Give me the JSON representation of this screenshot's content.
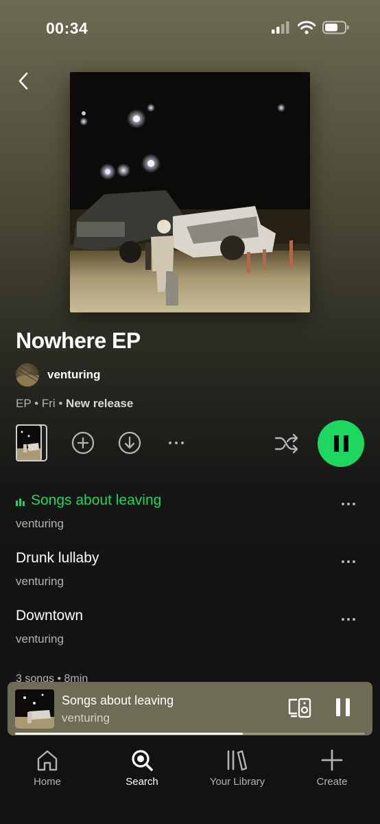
{
  "status_bar": {
    "time": "00:34"
  },
  "album": {
    "title": "Nowhere EP",
    "artist": "venturing",
    "meta": {
      "type": "EP",
      "date": "Fri",
      "tag": "New release"
    }
  },
  "tracks": [
    {
      "title": "Songs about leaving",
      "artist": "venturing",
      "playing": true
    },
    {
      "title": "Drunk lullaby",
      "artist": "venturing",
      "playing": false
    },
    {
      "title": "Downtown",
      "artist": "venturing",
      "playing": false
    }
  ],
  "summary": "3 songs • 8min",
  "mini_player": {
    "title": "Songs about leaving",
    "artist": "venturing",
    "progress": 0.65
  },
  "nav": [
    {
      "label": "Home",
      "icon": "home-icon"
    },
    {
      "label": "Search",
      "icon": "search-icon",
      "active": true
    },
    {
      "label": "Your Library",
      "icon": "library-icon"
    },
    {
      "label": "Create",
      "icon": "plus-icon"
    }
  ],
  "colors": {
    "accent": "#1ed760",
    "background": "#121212",
    "mini_player": "#6f6c55"
  }
}
